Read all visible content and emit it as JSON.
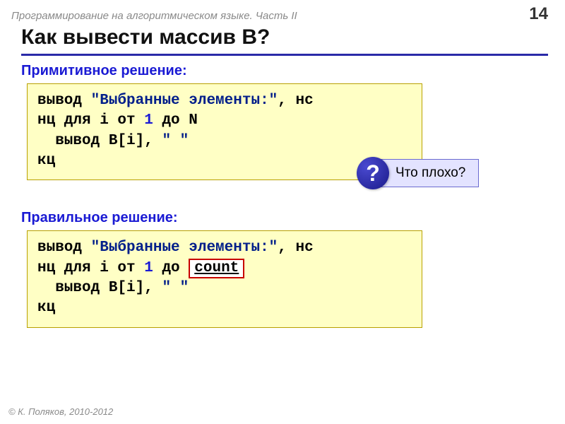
{
  "header": {
    "course": "Программирование на алгоритмическом языке. Часть II",
    "page": "14"
  },
  "title": "Как вывести массив B?",
  "section1": {
    "label": "Примитивное решение:",
    "code": {
      "l1a": "вывод ",
      "l1b": "\"Выбранные элементы:\"",
      "l1c": ", нс",
      "l2a": "нц для i от ",
      "l2b": "1",
      "l2c": " до ",
      "l2d": "N",
      "l3a": "  вывод B[i], ",
      "l3b": "\" \"",
      "l4a": "кц"
    }
  },
  "hint": {
    "mark": "?",
    "text": "Что плохо?"
  },
  "section2": {
    "label": "Правильное решение:",
    "code": {
      "l1a": "вывод ",
      "l1b": "\"Выбранные элементы:\"",
      "l1c": ", нс",
      "l2a": "нц для i от ",
      "l2b": "1",
      "l2c": " до ",
      "l2d": "count",
      "l3a": "  вывод B[i], ",
      "l3b": "\" \"",
      "l4a": "кц"
    }
  },
  "footer": "© К. Поляков, 2010-2012"
}
